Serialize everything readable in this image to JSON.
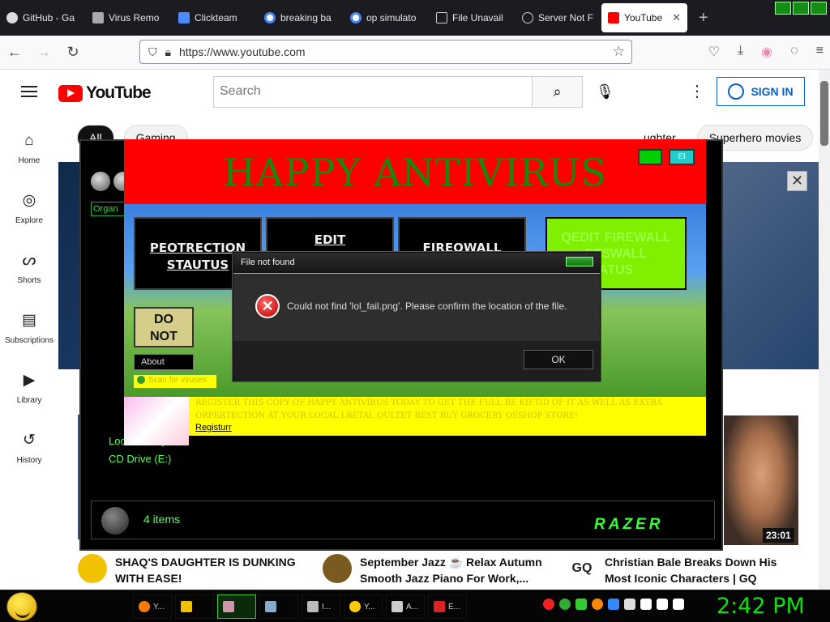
{
  "browser": {
    "tabs": [
      {
        "title": "GitHub - Ga",
        "color": "#ddd"
      },
      {
        "title": "Virus Remo",
        "color": "#aaa"
      },
      {
        "title": "Clickteam",
        "color": "#4a8cff"
      },
      {
        "title": "breaking ba",
        "color": "#4285f4"
      },
      {
        "title": "op simulato",
        "color": "#4285f4"
      },
      {
        "title": "File Unavail",
        "color": "#888"
      },
      {
        "title": "Server Not F",
        "color": "#888"
      },
      {
        "title": "YouTube",
        "color": "#ff0000"
      }
    ],
    "new_tab": "+",
    "url": "https://www.youtube.com"
  },
  "youtube": {
    "logo": "YouTube",
    "search_placeholder": "Search",
    "sign_in": "SIGN IN",
    "sidebar": [
      {
        "label": "Home",
        "icon": "⌂"
      },
      {
        "label": "Explore",
        "icon": "◎"
      },
      {
        "label": "Shorts",
        "icon": "ᔕ"
      },
      {
        "label": "Subscriptions",
        "icon": "▤"
      },
      {
        "label": "Library",
        "icon": "▶"
      },
      {
        "label": "History",
        "icon": "↺"
      }
    ],
    "chips": [
      "All",
      "Gaming",
      "ughter",
      "Superhero movies"
    ],
    "duration": "23:01",
    "videos": [
      {
        "title1": "SHAQ'S DAUGHTER IS DUNKING",
        "title2": "WITH EASE!",
        "color": "#f2c200"
      },
      {
        "title1": "September Jazz ☕ Relax Autumn",
        "title2": "Smooth Jazz Piano For Work,...",
        "color": "#7a5a20"
      },
      {
        "title1": "Christian Bale Breaks Down His",
        "title2": "Most Iconic Characters | GQ",
        "color": "#fff"
      }
    ]
  },
  "explorer": {
    "organize": "Organ",
    "tree": [
      "Local Disk (",
      "CD Drive (E:)"
    ],
    "status": "4 items",
    "brand": "RAZER"
  },
  "antivirus": {
    "title": "HAPPY ANTIVIRUS",
    "btn_small": "EI",
    "buttons": [
      {
        "label1": "PEOTRECTION",
        "label2": "STAUTUS"
      },
      {
        "label1": "EDIT",
        "label2": ""
      },
      {
        "label1": "FIREQWALL",
        "label2": ""
      }
    ],
    "green_btn": [
      "QEDIT FIREWALL",
      "ETSWALL",
      "ATUS"
    ],
    "do_not": [
      "DO",
      "NOT"
    ],
    "about": "About",
    "scan": "Scan for viruses",
    "register_text": "REGISTER THIS COPY OF HAPPY ANTIVIRUS TODAY TO GET THE FULL BE KIFTID OF IT AS WELL AS EXTRA ORPERTECTION AT YOUR LOCAL LRETAL OULTET BEST BUY GROCERY OSSHOP STORE!",
    "register_link": "Registurr"
  },
  "dialog": {
    "title": "File not found",
    "message": "Could not find 'lol_fail.png'. Please confirm the location of the file.",
    "ok": "OK",
    "error_glyph": "✕"
  },
  "taskbar": {
    "tasks": [
      {
        "label": "Y...",
        "color": "#ff7a00"
      },
      {
        "label": "",
        "color": "#f0c000"
      },
      {
        "label": "",
        "color": "#c9a"
      },
      {
        "label": "",
        "color": "#8ac"
      },
      {
        "label": "I...",
        "color": "#bbb"
      },
      {
        "label": "Y...",
        "color": "#fc0"
      },
      {
        "label": "A...",
        "color": "#ccc"
      },
      {
        "label": "E...",
        "color": "#d22"
      }
    ],
    "tray_colors": [
      "#e22",
      "#3a3",
      "#3c3",
      "#f80",
      "#38f",
      "#ddd",
      "#fff",
      "#fff",
      "#fff"
    ],
    "clock": "2:42 PM"
  }
}
